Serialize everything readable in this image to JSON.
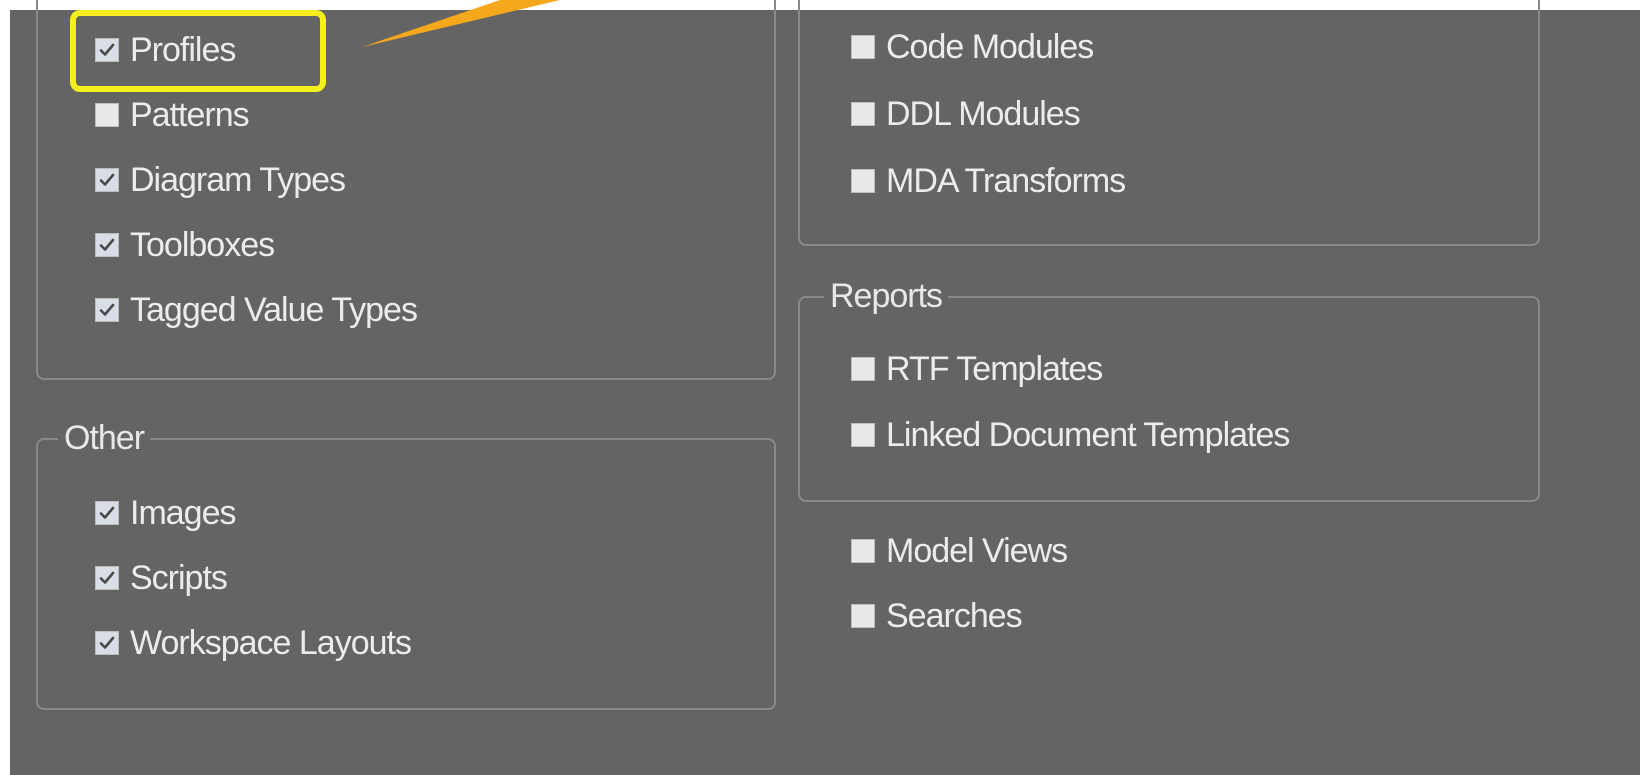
{
  "left_top_group": {
    "items": [
      {
        "label": "Profiles",
        "checked": true
      },
      {
        "label": "Patterns",
        "checked": false
      },
      {
        "label": "Diagram Types",
        "checked": true
      },
      {
        "label": "Toolboxes",
        "checked": true
      },
      {
        "label": "Tagged Value Types",
        "checked": true
      }
    ]
  },
  "other_group": {
    "title": "Other",
    "items": [
      {
        "label": "Images",
        "checked": true
      },
      {
        "label": "Scripts",
        "checked": true
      },
      {
        "label": "Workspace Layouts",
        "checked": true
      }
    ]
  },
  "right_top_group": {
    "items": [
      {
        "label": "Code Modules",
        "checked": false
      },
      {
        "label": "DDL Modules",
        "checked": false
      },
      {
        "label": "MDA Transforms",
        "checked": false
      }
    ]
  },
  "reports_group": {
    "title": "Reports",
    "items": [
      {
        "label": "RTF Templates",
        "checked": false
      },
      {
        "label": "Linked Document Templates",
        "checked": false
      }
    ]
  },
  "loose_items": [
    {
      "label": "Model Views",
      "checked": false
    },
    {
      "label": "Searches",
      "checked": false
    }
  ],
  "annotation": {
    "highlight_color": "#f5ef1e",
    "arrow_color": "#f5a81c"
  }
}
